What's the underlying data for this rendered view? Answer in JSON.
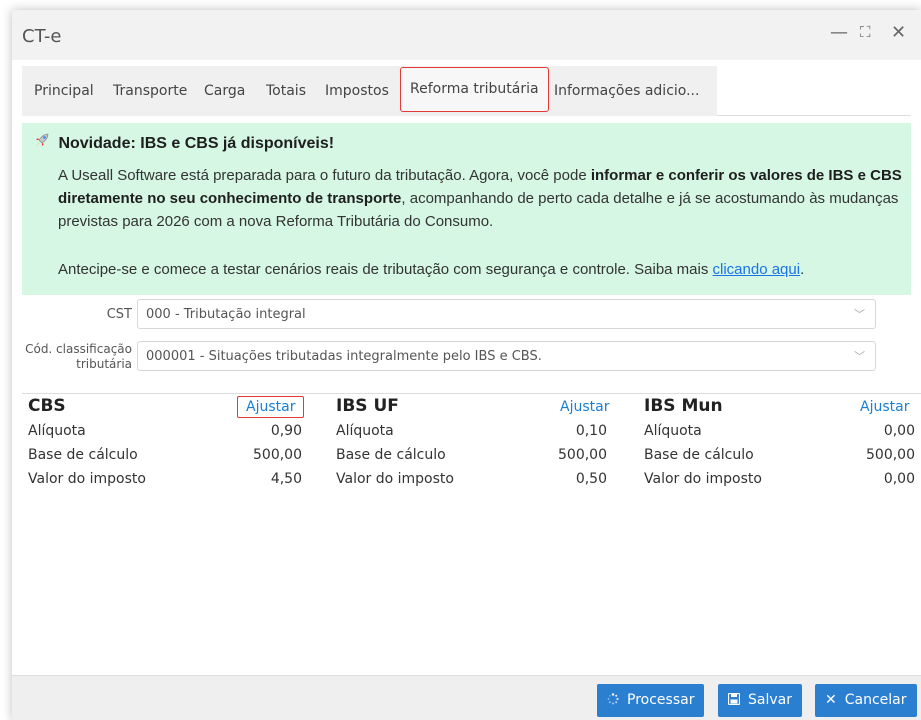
{
  "window": {
    "title": "CT-e",
    "controls": {
      "minimize": "—",
      "maximize": "⛶",
      "close": "✕"
    }
  },
  "tabs": [
    {
      "label": "Principal"
    },
    {
      "label": "Transporte"
    },
    {
      "label": "Carga"
    },
    {
      "label": "Totais"
    },
    {
      "label": "Impostos"
    },
    {
      "label": "Reforma tributária",
      "active": true
    },
    {
      "label": "Informações adicio..."
    }
  ],
  "banner": {
    "icon": "rocket-icon",
    "title": "Novidade: IBS e CBS já disponíveis!",
    "p1_pre": "A Useall Software está preparada para o futuro da tributação. Agora, você pode ",
    "p1_bold": "informar e conferir os valores de IBS e CBS diretamente no seu conhecimento de transporte",
    "p1_post": ", acompanhando de perto cada detalhe e já se acostumando às mudanças previstas para 2026 com a nova Reforma Tributária do Consumo.",
    "p2_pre": "Antecipe-se e comece a testar cenários reais de tributação com segurança e controle. Saiba mais ",
    "p2_link": "clicando aqui",
    "p2_post": ".",
    "bg_color": "#d5f7e4"
  },
  "form": {
    "cst_label": "CST",
    "cst_value": "000 - Tributação integral",
    "class_label_1": "Cód. classificação",
    "class_label_2": "tributária",
    "class_value": "000001 - Situações tributadas integralmente pelo IBS e CBS."
  },
  "taxes": [
    {
      "title": "CBS",
      "adjust": "Ajustar",
      "rows": [
        {
          "label": "Alíquota",
          "value": "0,90"
        },
        {
          "label": "Base de cálculo",
          "value": "500,00"
        },
        {
          "label": "Valor do imposto",
          "value": "4,50"
        }
      ]
    },
    {
      "title": "IBS UF",
      "adjust": "Ajustar",
      "rows": [
        {
          "label": "Alíquota",
          "value": "0,10"
        },
        {
          "label": "Base de cálculo",
          "value": "500,00"
        },
        {
          "label": "Valor do imposto",
          "value": "0,50"
        }
      ]
    },
    {
      "title": "IBS Mun",
      "adjust": "Ajustar",
      "rows": [
        {
          "label": "Alíquota",
          "value": "0,00"
        },
        {
          "label": "Base de cálculo",
          "value": "500,00"
        },
        {
          "label": "Valor do imposto",
          "value": "0,00"
        }
      ]
    }
  ],
  "footer": {
    "process_label": "Processar",
    "save_label": "Salvar",
    "cancel_label": "Cancelar",
    "button_color": "#2b7fd1"
  }
}
